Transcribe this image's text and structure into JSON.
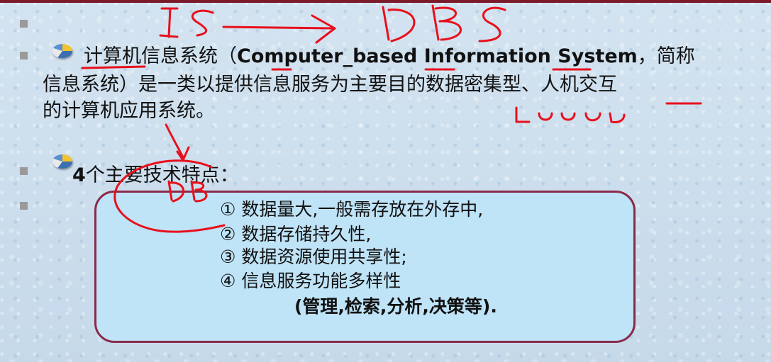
{
  "slide": {
    "line1": {
      "prefix": "计算机信息系统（",
      "bold": "Computer_based Information System",
      "suffix": "，简称"
    },
    "line2": "信息系统）是一类以提供信息服务为主要目的数据密集型、人机交互",
    "line3": "的计算机应用系统。",
    "features_heading_num": "4",
    "features_heading_text": "个主要技术特点：",
    "features": [
      "① 数据量大,一般需存放在外存中,",
      "② 数据存储持久性,",
      "③ 数据资源使用共享性;",
      "④ 信息服务功能多样性"
    ],
    "features_note": "(管理,检索,分析,决策等)."
  },
  "annotations": {
    "top_left": "IS",
    "top_right": "DBS",
    "near_box": "DB"
  },
  "colors": {
    "ink": "#e8101c",
    "box_border": "#8a2a4a",
    "box_fill": "#bfe3f7",
    "top_bar": "#7b1a2a"
  }
}
